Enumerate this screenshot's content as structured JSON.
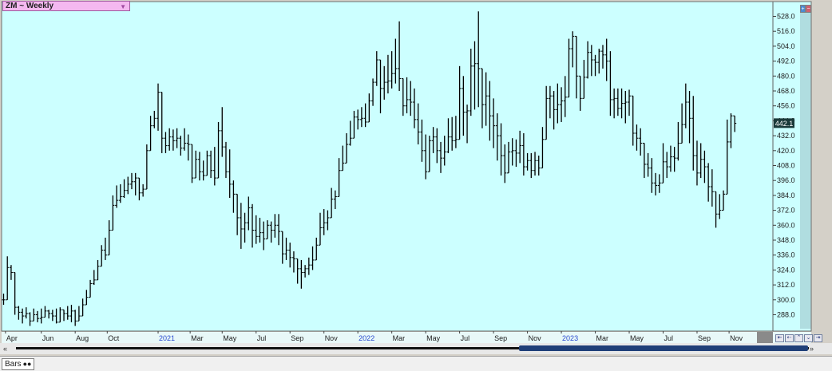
{
  "title": "ZM ~ Weekly",
  "last_price": "442.1",
  "bottom_tab": "Bars",
  "colors": {
    "background": "#ccffff",
    "bar": "#000000",
    "price_box": "#1a3a3a",
    "axis_bg": "#ccffff"
  },
  "icons": [
    "dropdown-arrow-icon",
    "scroll-left-icon",
    "scroll-right-icon",
    "zoom-icons"
  ],
  "chart_data": {
    "type": "ohlc",
    "interval": "weekly",
    "ylim": [
      276,
      536
    ],
    "yticks": [
      "528.0",
      "516.0",
      "504.0",
      "492.0",
      "480.0",
      "468.0",
      "456.0",
      "444.0",
      "432.0",
      "420.0",
      "408.0",
      "396.0",
      "384.0",
      "372.0",
      "360.0",
      "348.0",
      "336.0",
      "324.0",
      "312.0",
      "300.0",
      "288.0"
    ],
    "xticks": [
      {
        "label": "Apr",
        "week": 0.5,
        "year": false
      },
      {
        "label": "Jun",
        "week": 10,
        "year": false
      },
      {
        "label": "Aug",
        "week": 19,
        "year": false
      },
      {
        "label": "Oct",
        "week": 27.5,
        "year": false
      },
      {
        "label": "2021",
        "week": 41,
        "year": true
      },
      {
        "label": "Mar",
        "week": 49.5,
        "year": false
      },
      {
        "label": "May",
        "week": 58,
        "year": false
      },
      {
        "label": "Jul",
        "week": 67,
        "year": false
      },
      {
        "label": "Sep",
        "week": 76,
        "year": false
      },
      {
        "label": "Nov",
        "week": 85,
        "year": false
      },
      {
        "label": "2022",
        "week": 94,
        "year": true
      },
      {
        "label": "Mar",
        "week": 103,
        "year": false
      },
      {
        "label": "May",
        "week": 112,
        "year": false
      },
      {
        "label": "Jul",
        "week": 121,
        "year": false
      },
      {
        "label": "Sep",
        "week": 130,
        "year": false
      },
      {
        "label": "Nov",
        "week": 139,
        "year": false
      },
      {
        "label": "2023",
        "week": 148,
        "year": true
      },
      {
        "label": "Mar",
        "week": 157,
        "year": false
      },
      {
        "label": "May",
        "week": 166,
        "year": false
      },
      {
        "label": "Jul",
        "week": 175,
        "year": false
      },
      {
        "label": "Sep",
        "week": 184,
        "year": false
      },
      {
        "label": "Nov",
        "week": 192.5,
        "year": false
      }
    ],
    "closes": [
      300,
      326,
      322,
      294,
      290,
      287,
      289,
      283,
      288,
      285,
      286,
      291,
      289,
      287,
      282,
      292,
      289,
      287,
      291,
      283,
      287,
      296,
      302,
      313,
      316,
      327,
      340,
      336,
      356,
      376,
      380,
      383,
      388,
      393,
      395,
      398,
      386,
      389,
      420,
      440,
      446,
      467,
      430,
      424,
      431,
      428,
      430,
      422,
      426,
      425,
      398,
      413,
      403,
      400,
      416,
      404,
      398,
      436,
      423,
      403,
      393,
      385,
      366,
      357,
      362,
      374,
      356,
      351,
      354,
      349,
      360,
      356,
      360,
      355,
      337,
      340,
      334,
      333,
      325,
      322,
      325,
      328,
      332,
      344,
      358,
      362,
      366,
      381,
      383,
      404,
      410,
      425,
      430,
      447,
      445,
      446,
      443,
      460,
      475,
      493,
      470,
      475,
      476,
      482,
      486,
      478,
      456,
      461,
      459,
      445,
      435,
      420,
      403,
      428,
      431,
      420,
      414,
      419,
      431,
      428,
      429,
      470,
      451,
      452,
      488,
      490,
      486,
      457,
      464,
      448,
      440,
      432,
      416,
      402,
      419,
      420,
      418,
      424,
      407,
      412,
      404,
      412,
      406,
      429,
      462,
      464,
      453,
      457,
      460,
      463,
      502,
      512,
      480,
      462,
      479,
      499,
      493,
      491,
      500,
      497,
      492,
      461,
      462,
      454,
      458,
      459,
      464,
      434,
      430,
      426,
      409,
      406,
      394,
      392,
      394,
      411,
      407,
      415,
      414,
      426,
      441,
      459,
      446,
      416,
      402,
      413,
      407,
      391,
      387,
      369,
      372,
      385,
      427,
      448,
      442
    ],
    "highs": [
      305,
      335,
      328,
      300,
      295,
      293,
      294,
      290,
      293,
      291,
      293,
      295,
      292,
      292,
      293,
      294,
      292,
      295,
      296,
      292,
      295,
      301,
      308,
      316,
      324,
      332,
      344,
      350,
      364,
      384,
      392,
      393,
      397,
      399,
      402,
      402,
      396,
      393,
      425,
      448,
      452,
      474,
      448,
      435,
      438,
      437,
      438,
      432,
      438,
      433,
      417,
      420,
      419,
      412,
      420,
      420,
      423,
      443,
      455,
      427,
      421,
      396,
      384,
      378,
      370,
      383,
      377,
      368,
      366,
      363,
      364,
      363,
      369,
      369,
      350,
      350,
      346,
      339,
      333,
      332,
      328,
      334,
      343,
      350,
      370,
      373,
      372,
      390,
      388,
      414,
      424,
      434,
      444,
      452,
      453,
      455,
      458,
      466,
      478,
      500,
      480,
      488,
      497,
      500,
      510,
      524,
      472,
      479,
      476,
      470,
      458,
      445,
      433,
      432,
      439,
      438,
      427,
      432,
      446,
      447,
      448,
      488,
      480,
      457,
      502,
      508,
      532,
      463,
      483,
      476,
      462,
      450,
      442,
      425,
      427,
      430,
      429,
      436,
      434,
      418,
      418,
      419,
      416,
      439,
      472,
      472,
      468,
      474,
      471,
      480,
      510,
      516,
      490,
      472,
      493,
      508,
      505,
      497,
      502,
      505,
      510,
      500,
      470,
      470,
      470,
      468,
      469,
      450,
      441,
      438,
      423,
      418,
      414,
      402,
      401,
      426,
      419,
      424,
      423,
      443,
      458,
      474,
      468,
      464,
      428,
      426,
      420,
      410,
      405,
      384,
      385,
      388,
      445,
      450,
      447
    ],
    "lows": [
      296,
      322,
      316,
      288,
      284,
      281,
      285,
      279,
      284,
      282,
      281,
      287,
      285,
      283,
      281,
      287,
      283,
      284,
      282,
      279,
      283,
      292,
      297,
      304,
      312,
      322,
      333,
      332,
      346,
      366,
      374,
      378,
      382,
      385,
      389,
      384,
      380,
      383,
      412,
      432,
      438,
      436,
      418,
      418,
      420,
      420,
      422,
      416,
      420,
      412,
      394,
      398,
      396,
      396,
      402,
      398,
      392,
      402,
      415,
      398,
      382,
      370,
      352,
      341,
      346,
      356,
      342,
      345,
      346,
      340,
      350,
      346,
      350,
      344,
      329,
      332,
      326,
      322,
      313,
      309,
      318,
      320,
      324,
      333,
      344,
      352,
      356,
      368,
      373,
      398,
      406,
      414,
      424,
      435,
      437,
      439,
      439,
      450,
      456,
      472,
      450,
      461,
      466,
      470,
      474,
      468,
      448,
      450,
      448,
      438,
      425,
      411,
      397,
      412,
      418,
      410,
      402,
      408,
      418,
      420,
      422,
      440,
      432,
      426,
      448,
      453,
      455,
      438,
      440,
      428,
      422,
      412,
      400,
      394,
      405,
      408,
      407,
      410,
      400,
      404,
      398,
      400,
      400,
      410,
      440,
      446,
      437,
      442,
      443,
      447,
      474,
      487,
      462,
      452,
      468,
      478,
      480,
      480,
      482,
      486,
      476,
      448,
      446,
      448,
      446,
      442,
      448,
      424,
      420,
      416,
      398,
      399,
      386,
      384,
      386,
      400,
      398,
      403,
      403,
      412,
      428,
      438,
      426,
      404,
      392,
      398,
      394,
      379,
      375,
      358,
      365,
      378,
      410,
      422,
      435
    ]
  }
}
